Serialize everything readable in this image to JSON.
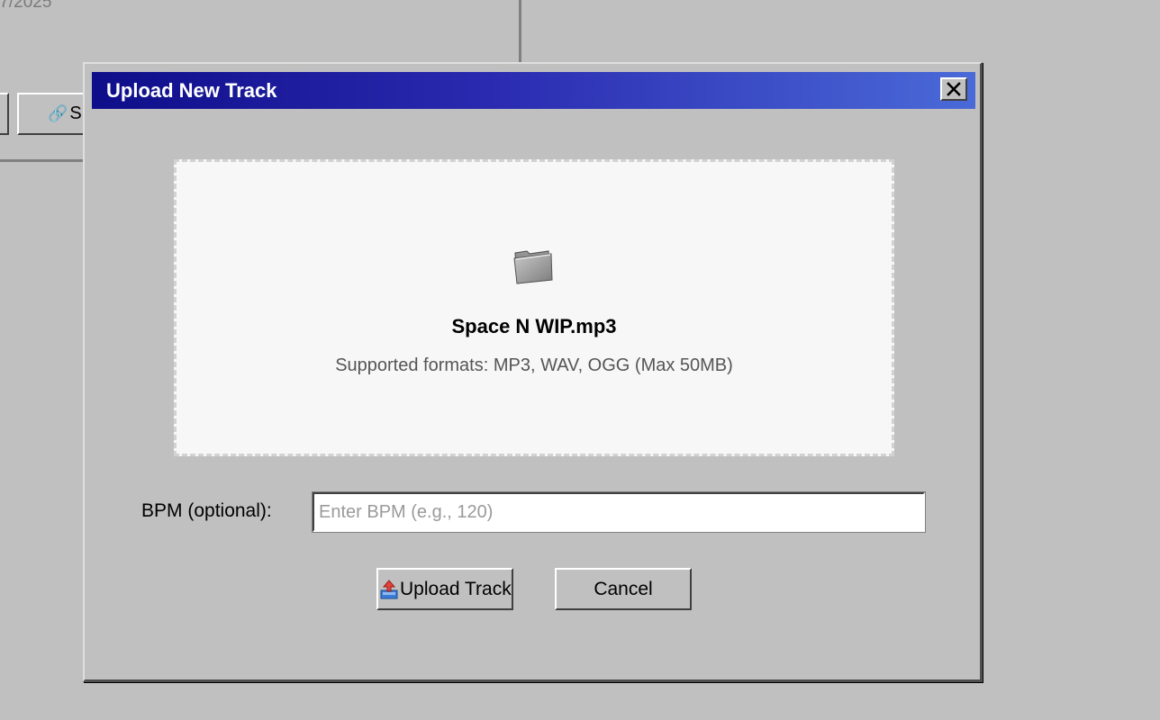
{
  "background": {
    "date_fragment": "/7/2025",
    "share_button_label": "Sh",
    "share_icon": "link-icon"
  },
  "dialog": {
    "title": "Upload New Track",
    "close_icon": "close-icon",
    "dropzone": {
      "icon": "folder-icon",
      "file_name": "Space N WIP.mp3",
      "formats_text": "Supported formats: MP3, WAV, OGG (Max 50MB)"
    },
    "bpm": {
      "label": "BPM (optional):",
      "placeholder": "Enter BPM (e.g., 120)",
      "value": ""
    },
    "buttons": {
      "upload_label": "Upload Track",
      "upload_icon": "upload-icon",
      "cancel_label": "Cancel"
    }
  },
  "colors": {
    "window_bg": "#c0c0c0",
    "title_gradient_start": "#0e0e8a",
    "title_gradient_end": "#4a6ad8",
    "dropzone_bg": "#f7f7f7"
  }
}
